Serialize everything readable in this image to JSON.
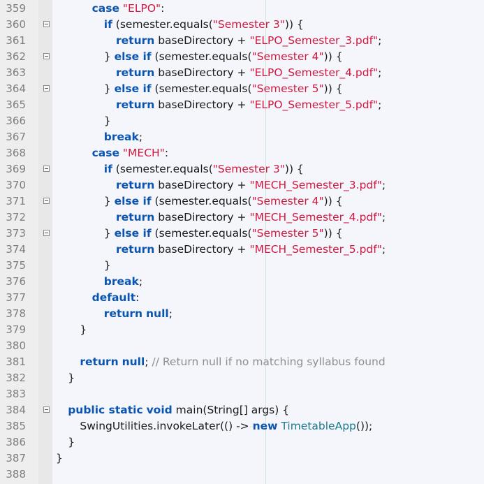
{
  "editor": {
    "lines": [
      {
        "number": "359",
        "indent": "      ",
        "fold": false,
        "tokens": [
          {
            "t": "case",
            "k": "kw"
          },
          {
            "t": " ",
            "k": "pl"
          },
          {
            "t": "\"ELPO\"",
            "k": "st"
          },
          {
            "t": ":",
            "k": "pl"
          }
        ]
      },
      {
        "number": "360",
        "indent": "        ",
        "fold": true,
        "tokens": [
          {
            "t": "if",
            "k": "kw"
          },
          {
            "t": " (semester.equals(",
            "k": "pl"
          },
          {
            "t": "\"Semester 3\"",
            "k": "st"
          },
          {
            "t": ")) {",
            "k": "pl"
          }
        ]
      },
      {
        "number": "361",
        "indent": "          ",
        "fold": false,
        "tokens": [
          {
            "t": "return",
            "k": "kw"
          },
          {
            "t": " baseDirectory + ",
            "k": "pl"
          },
          {
            "t": "\"ELPO_Semester_3.pdf\"",
            "k": "st"
          },
          {
            "t": ";",
            "k": "pl"
          }
        ]
      },
      {
        "number": "362",
        "indent": "        ",
        "fold": true,
        "tokens": [
          {
            "t": "} ",
            "k": "pl"
          },
          {
            "t": "else if",
            "k": "kw"
          },
          {
            "t": " (semester.equals(",
            "k": "pl"
          },
          {
            "t": "\"Semester 4\"",
            "k": "st"
          },
          {
            "t": ")) {",
            "k": "pl"
          }
        ]
      },
      {
        "number": "363",
        "indent": "          ",
        "fold": false,
        "tokens": [
          {
            "t": "return",
            "k": "kw"
          },
          {
            "t": " baseDirectory + ",
            "k": "pl"
          },
          {
            "t": "\"ELPO_Semester_4.pdf\"",
            "k": "st"
          },
          {
            "t": ";",
            "k": "pl"
          }
        ]
      },
      {
        "number": "364",
        "indent": "        ",
        "fold": true,
        "tokens": [
          {
            "t": "} ",
            "k": "pl"
          },
          {
            "t": "else if",
            "k": "kw"
          },
          {
            "t": " (semester.equals(",
            "k": "pl"
          },
          {
            "t": "\"Semester 5\"",
            "k": "st"
          },
          {
            "t": ")) {",
            "k": "pl"
          }
        ]
      },
      {
        "number": "365",
        "indent": "          ",
        "fold": false,
        "tokens": [
          {
            "t": "return",
            "k": "kw"
          },
          {
            "t": " baseDirectory + ",
            "k": "pl"
          },
          {
            "t": "\"ELPO_Semester_5.pdf\"",
            "k": "st"
          },
          {
            "t": ";",
            "k": "pl"
          }
        ]
      },
      {
        "number": "366",
        "indent": "        ",
        "fold": false,
        "tokens": [
          {
            "t": "}",
            "k": "pl"
          }
        ]
      },
      {
        "number": "367",
        "indent": "        ",
        "fold": false,
        "tokens": [
          {
            "t": "break",
            "k": "kw"
          },
          {
            "t": ";",
            "k": "pl"
          }
        ]
      },
      {
        "number": "368",
        "indent": "      ",
        "fold": false,
        "tokens": [
          {
            "t": "case",
            "k": "kw"
          },
          {
            "t": " ",
            "k": "pl"
          },
          {
            "t": "\"MECH\"",
            "k": "st"
          },
          {
            "t": ":",
            "k": "pl"
          }
        ]
      },
      {
        "number": "369",
        "indent": "        ",
        "fold": true,
        "tokens": [
          {
            "t": "if",
            "k": "kw"
          },
          {
            "t": " (semester.equals(",
            "k": "pl"
          },
          {
            "t": "\"Semester 3\"",
            "k": "st"
          },
          {
            "t": ")) {",
            "k": "pl"
          }
        ]
      },
      {
        "number": "370",
        "indent": "          ",
        "fold": false,
        "tokens": [
          {
            "t": "return",
            "k": "kw"
          },
          {
            "t": " baseDirectory + ",
            "k": "pl"
          },
          {
            "t": "\"MECH_Semester_3.pdf\"",
            "k": "st"
          },
          {
            "t": ";",
            "k": "pl"
          }
        ]
      },
      {
        "number": "371",
        "indent": "        ",
        "fold": true,
        "tokens": [
          {
            "t": "} ",
            "k": "pl"
          },
          {
            "t": "else if",
            "k": "kw"
          },
          {
            "t": " (semester.equals(",
            "k": "pl"
          },
          {
            "t": "\"Semester 4\"",
            "k": "st"
          },
          {
            "t": ")) {",
            "k": "pl"
          }
        ]
      },
      {
        "number": "372",
        "indent": "          ",
        "fold": false,
        "tokens": [
          {
            "t": "return",
            "k": "kw"
          },
          {
            "t": " baseDirectory + ",
            "k": "pl"
          },
          {
            "t": "\"MECH_Semester_4.pdf\"",
            "k": "st"
          },
          {
            "t": ";",
            "k": "pl"
          }
        ]
      },
      {
        "number": "373",
        "indent": "        ",
        "fold": true,
        "tokens": [
          {
            "t": "} ",
            "k": "pl"
          },
          {
            "t": "else if",
            "k": "kw"
          },
          {
            "t": " (semester.equals(",
            "k": "pl"
          },
          {
            "t": "\"Semester 5\"",
            "k": "st"
          },
          {
            "t": ")) {",
            "k": "pl"
          }
        ]
      },
      {
        "number": "374",
        "indent": "          ",
        "fold": false,
        "tokens": [
          {
            "t": "return",
            "k": "kw"
          },
          {
            "t": " baseDirectory + ",
            "k": "pl"
          },
          {
            "t": "\"MECH_Semester_5.pdf\"",
            "k": "st"
          },
          {
            "t": ";",
            "k": "pl"
          }
        ]
      },
      {
        "number": "375",
        "indent": "        ",
        "fold": false,
        "tokens": [
          {
            "t": "}",
            "k": "pl"
          }
        ]
      },
      {
        "number": "376",
        "indent": "        ",
        "fold": false,
        "tokens": [
          {
            "t": "break",
            "k": "kw"
          },
          {
            "t": ";",
            "k": "pl"
          }
        ]
      },
      {
        "number": "377",
        "indent": "      ",
        "fold": false,
        "tokens": [
          {
            "t": "default",
            "k": "kw"
          },
          {
            "t": ":",
            "k": "pl"
          }
        ]
      },
      {
        "number": "378",
        "indent": "        ",
        "fold": false,
        "tokens": [
          {
            "t": "return",
            "k": "kw"
          },
          {
            "t": " ",
            "k": "pl"
          },
          {
            "t": "null",
            "k": "kw"
          },
          {
            "t": ";",
            "k": "pl"
          }
        ]
      },
      {
        "number": "379",
        "indent": "    ",
        "fold": false,
        "tokens": [
          {
            "t": "}",
            "k": "pl"
          }
        ]
      },
      {
        "number": "380",
        "indent": "",
        "fold": false,
        "tokens": []
      },
      {
        "number": "381",
        "indent": "    ",
        "fold": false,
        "tokens": [
          {
            "t": "return",
            "k": "kw"
          },
          {
            "t": " ",
            "k": "pl"
          },
          {
            "t": "null",
            "k": "kw"
          },
          {
            "t": "; ",
            "k": "pl"
          },
          {
            "t": "// Return null if no matching syllabus found",
            "k": "cm"
          }
        ]
      },
      {
        "number": "382",
        "indent": "  ",
        "fold": false,
        "tokens": [
          {
            "t": "}",
            "k": "pl"
          }
        ]
      },
      {
        "number": "383",
        "indent": "",
        "fold": false,
        "tokens": []
      },
      {
        "number": "384",
        "indent": "  ",
        "fold": true,
        "tokens": [
          {
            "t": "public static",
            "k": "kw"
          },
          {
            "t": " ",
            "k": "pl"
          },
          {
            "t": "void",
            "k": "kw"
          },
          {
            "t": " main(String[] args) {",
            "k": "pl"
          }
        ]
      },
      {
        "number": "385",
        "indent": "    ",
        "fold": false,
        "tokens": [
          {
            "t": "SwingUtilities.invokeLater(() -> ",
            "k": "pl"
          },
          {
            "t": "new",
            "k": "kw"
          },
          {
            "t": " ",
            "k": "pl"
          },
          {
            "t": "TimetableApp",
            "k": "ty"
          },
          {
            "t": "());",
            "k": "pl"
          }
        ]
      },
      {
        "number": "386",
        "indent": "  ",
        "fold": false,
        "tokens": [
          {
            "t": "}",
            "k": "pl"
          }
        ]
      },
      {
        "number": "387",
        "indent": "",
        "fold": false,
        "tokens": [
          {
            "t": "}",
            "k": "pl"
          }
        ]
      },
      {
        "number": "388",
        "indent": "",
        "fold": false,
        "tokens": []
      }
    ]
  }
}
